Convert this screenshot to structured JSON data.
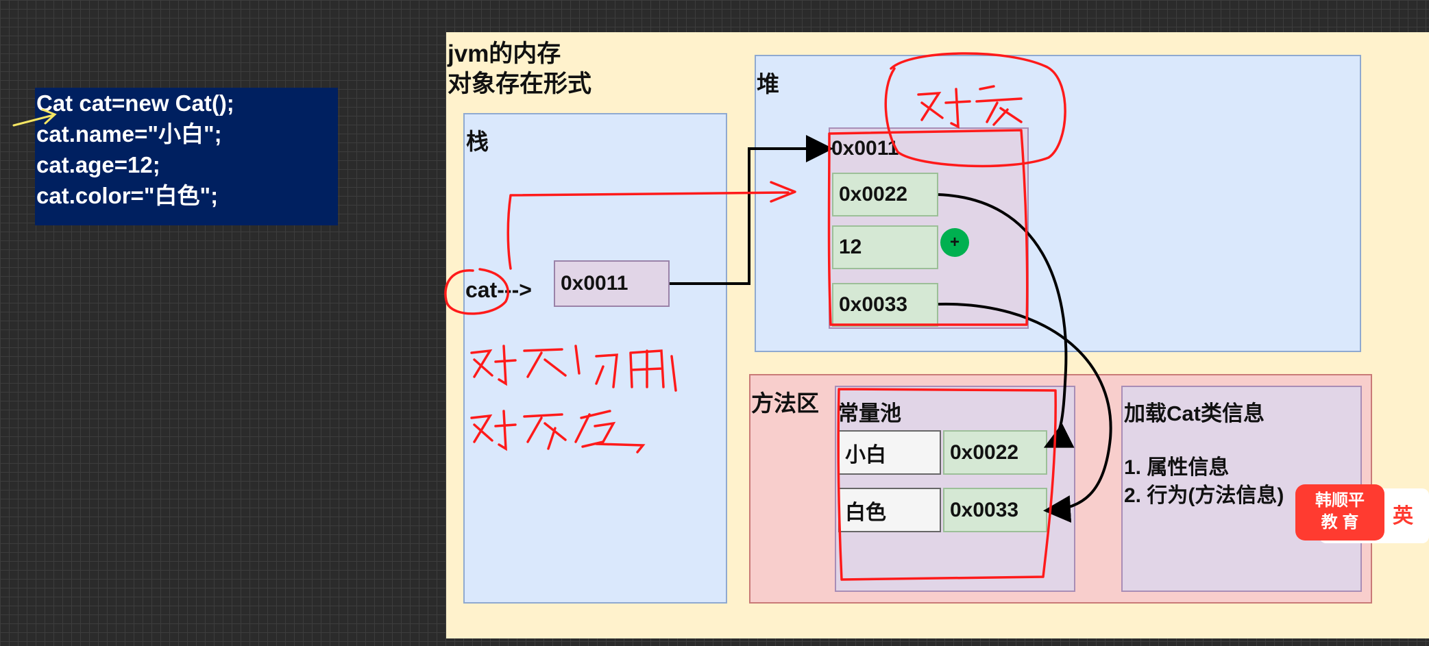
{
  "code": {
    "lines": [
      "Cat cat=new Cat();",
      "cat.name=\"小白\";",
      "cat.age=12;",
      "cat.color=\"白色\";"
    ]
  },
  "diagram": {
    "title_line1": "jvm的内存",
    "title_line2": "对象存在形式",
    "stack_label": "栈",
    "stack_var": "cat--->",
    "stack_ref": "0x0011",
    "heap_label": "堆",
    "heap_addr": "0x0011",
    "heap_fields": [
      "0x0022",
      "12",
      "0x0033"
    ],
    "method_label": "方法区",
    "pool_label": "常量池",
    "pool_rows": [
      {
        "value": "小白",
        "addr": "0x0022"
      },
      {
        "value": "白色",
        "addr": "0x0033"
      }
    ],
    "class_title": "加载Cat类信息",
    "class_lines": [
      "1. 属性信息",
      "2. 行为(方法信息)"
    ],
    "add_symbol": "+"
  },
  "badge": {
    "line1": "韩顺平",
    "line2": "教 育",
    "side_text": "英"
  },
  "colors": {
    "background": "#2b2b2b",
    "code_bg": "#002060",
    "canvas_bg": "#fff2cc",
    "heap_bg": "#dae8fc",
    "method_bg": "#f8cecc",
    "annotation": "#ff1a1a"
  }
}
